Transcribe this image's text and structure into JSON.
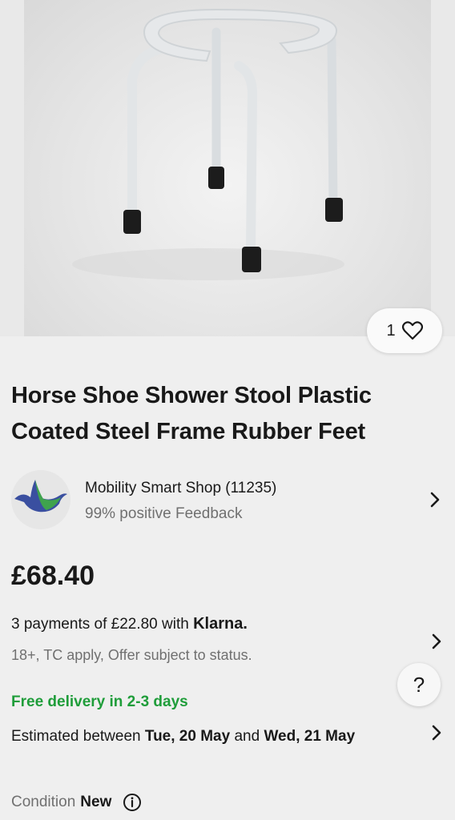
{
  "listing": {
    "title": "Horse Shoe Shower Stool Plastic Coated Steel Frame Rubber Feet",
    "watch_count": "1",
    "price": "£68.40"
  },
  "seller": {
    "name": "Mobility Smart Shop (11235)",
    "feedback": "99% positive Feedback"
  },
  "payments": {
    "installments_text": "3 payments of £22.80 with ",
    "provider": "Klarna.",
    "terms": "18+, TC apply, Offer subject to status."
  },
  "delivery": {
    "free_label": "Free delivery in 2-3 days",
    "estimate_prefix": "Estimated between ",
    "date_from": "Tue, 20 May",
    "estimate_mid": " and ",
    "date_to": "Wed, 21 May"
  },
  "condition": {
    "label": "Condition",
    "value": "New"
  },
  "help": {
    "label": "?"
  },
  "icons": {
    "watch": "heart-icon",
    "chevron": "chevron-right-icon",
    "info": "info-icon",
    "help": "help-icon"
  },
  "colors": {
    "free_delivery": "#1f9d3a",
    "secondary_text": "#707070",
    "primary_text": "#191919"
  }
}
